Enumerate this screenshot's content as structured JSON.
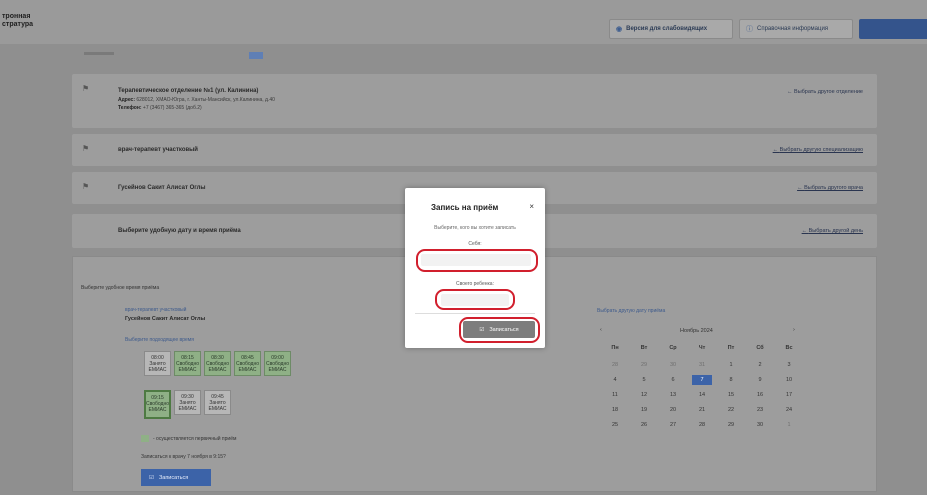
{
  "header": {
    "logo_line1": "тронная",
    "logo_line2": "стратура",
    "btn_vision": "Версия для слабовидящих",
    "btn_help": "Справочная информация"
  },
  "department": {
    "title": "Терапевтическое отделение №1 (ул. Калинина)",
    "address_label": "Адрес:",
    "address": "628012, ХМАО-Югра, г. Ханты-Мансийск, ул.Калинина, д.40",
    "phone_label": "Телефон:",
    "phone": "+7 (3467) 365-365 (доб.2)",
    "link": "Выбрать другое отделение"
  },
  "specialty": {
    "title": "врач-терапевт участковый",
    "link": "Выбрать другую специализацию"
  },
  "doctor": {
    "title": "Гусейнов Сакит Алисат Оглы",
    "link": "Выбрать другого врача"
  },
  "date_row": {
    "title": "Выберите удобную дату и время приёма",
    "link": "Выбрать другой день"
  },
  "schedule": {
    "heading": "Выберите удобное время приёма",
    "specialty": "врач-терапевт участковый",
    "doctor": "Гусейнов Сакит Алисат Оглы",
    "pick": "Выберите подходящее время",
    "slots_row1": [
      {
        "time": "08:00",
        "status": "Занято",
        "sub": "ЕМИАС"
      },
      {
        "time": "08:15",
        "status": "Свободно",
        "sub": "ЕМИАС"
      },
      {
        "time": "08:30",
        "status": "Свободно",
        "sub": "ЕМИАС"
      },
      {
        "time": "08:45",
        "status": "Свободно",
        "sub": "ЕМИАС"
      },
      {
        "time": "09:00",
        "status": "Свободно",
        "sub": "ЕМИАС"
      }
    ],
    "slots_row2": [
      {
        "time": "09:15",
        "status": "Свободно",
        "sub": "ЕМИАС"
      },
      {
        "time": "09:30",
        "status": "Занято",
        "sub": "ЕМИАС"
      },
      {
        "time": "09:45",
        "status": "Занято",
        "sub": "ЕМИАС"
      }
    ],
    "legend": "- осуществляется первичный приём",
    "summary": "Записаться к врачу 7 ноября в 9:15?",
    "submit": "Записаться"
  },
  "calendar": {
    "link": "Выбрать другую дату приёма",
    "month": "Ноябрь 2024",
    "prev": "‹",
    "next": "›",
    "weekdays": [
      "Пн",
      "Вт",
      "Ср",
      "Чт",
      "Пт",
      "Сб",
      "Вс"
    ],
    "weeks": [
      [
        "28",
        "29",
        "30",
        "31",
        "1",
        "2",
        "3"
      ],
      [
        "4",
        "5",
        "6",
        "7",
        "8",
        "9",
        "10"
      ],
      [
        "11",
        "12",
        "13",
        "14",
        "15",
        "16",
        "17"
      ],
      [
        "18",
        "19",
        "20",
        "21",
        "22",
        "23",
        "24"
      ],
      [
        "25",
        "26",
        "27",
        "28",
        "29",
        "30",
        "1"
      ]
    ],
    "selected": "7"
  },
  "modal": {
    "title": "Запись на приём",
    "close": "×",
    "subtitle": "Выберите, кого вы хотите записать",
    "self_label": "Себя:",
    "child_label": "Своего ребенка:",
    "submit": "Записаться"
  },
  "colors": {
    "accent": "#3c63a8",
    "highlight": "#d11f2d",
    "slot_free": "#8fb086"
  }
}
